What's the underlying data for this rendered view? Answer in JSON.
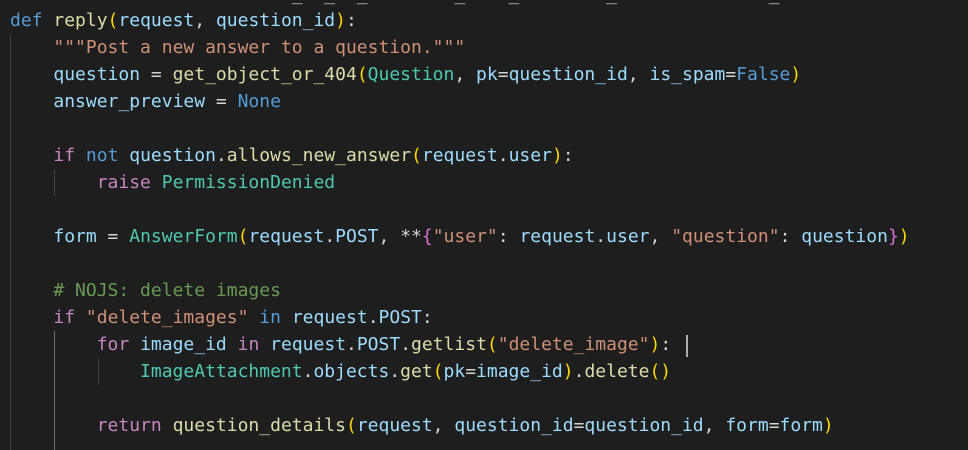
{
  "editor": {
    "language": "python",
    "top_cut_text": "                          _  _  _        _    _        _              _      ",
    "lines": [
      [
        {
          "t": "def",
          "c": "kw"
        },
        {
          "t": " ",
          "c": "pun"
        },
        {
          "t": "reply",
          "c": "fn"
        },
        {
          "t": "(",
          "c": "brk"
        },
        {
          "t": "request",
          "c": "var"
        },
        {
          "t": ", ",
          "c": "pun"
        },
        {
          "t": "question_id",
          "c": "var"
        },
        {
          "t": ")",
          "c": "brk"
        },
        {
          "t": ":",
          "c": "pun"
        }
      ],
      [
        {
          "t": "    ",
          "c": "pun"
        },
        {
          "t": "\"\"\"Post a new answer to a question.\"\"\"",
          "c": "str"
        }
      ],
      [
        {
          "t": "    ",
          "c": "pun"
        },
        {
          "t": "question",
          "c": "var"
        },
        {
          "t": " = ",
          "c": "pun"
        },
        {
          "t": "get_object_or_404",
          "c": "fn"
        },
        {
          "t": "(",
          "c": "brk"
        },
        {
          "t": "Question",
          "c": "cls"
        },
        {
          "t": ", ",
          "c": "pun"
        },
        {
          "t": "pk",
          "c": "var"
        },
        {
          "t": "=",
          "c": "pun"
        },
        {
          "t": "question_id",
          "c": "var"
        },
        {
          "t": ", ",
          "c": "pun"
        },
        {
          "t": "is_spam",
          "c": "var"
        },
        {
          "t": "=",
          "c": "pun"
        },
        {
          "t": "False",
          "c": "kw"
        },
        {
          "t": ")",
          "c": "brk"
        }
      ],
      [
        {
          "t": "    ",
          "c": "pun"
        },
        {
          "t": "answer_preview",
          "c": "var"
        },
        {
          "t": " = ",
          "c": "pun"
        },
        {
          "t": "None",
          "c": "kw"
        }
      ],
      [],
      [
        {
          "t": "    ",
          "c": "pun"
        },
        {
          "t": "if",
          "c": "ctrl"
        },
        {
          "t": " ",
          "c": "pun"
        },
        {
          "t": "not",
          "c": "kw"
        },
        {
          "t": " ",
          "c": "pun"
        },
        {
          "t": "question",
          "c": "var"
        },
        {
          "t": ".",
          "c": "pun"
        },
        {
          "t": "allows_new_answer",
          "c": "fn"
        },
        {
          "t": "(",
          "c": "brk"
        },
        {
          "t": "request",
          "c": "var"
        },
        {
          "t": ".",
          "c": "pun"
        },
        {
          "t": "user",
          "c": "var"
        },
        {
          "t": ")",
          "c": "brk"
        },
        {
          "t": ":",
          "c": "pun"
        }
      ],
      [
        {
          "t": "        ",
          "c": "pun"
        },
        {
          "t": "raise",
          "c": "ctrl"
        },
        {
          "t": " ",
          "c": "pun"
        },
        {
          "t": "PermissionDenied",
          "c": "cls"
        }
      ],
      [],
      [
        {
          "t": "    ",
          "c": "pun"
        },
        {
          "t": "form",
          "c": "var"
        },
        {
          "t": " = ",
          "c": "pun"
        },
        {
          "t": "AnswerForm",
          "c": "cls"
        },
        {
          "t": "(",
          "c": "brk"
        },
        {
          "t": "request",
          "c": "var"
        },
        {
          "t": ".",
          "c": "pun"
        },
        {
          "t": "POST",
          "c": "var"
        },
        {
          "t": ", **",
          "c": "pun"
        },
        {
          "t": "{",
          "c": "brk2"
        },
        {
          "t": "\"user\"",
          "c": "str"
        },
        {
          "t": ": ",
          "c": "pun"
        },
        {
          "t": "request",
          "c": "var"
        },
        {
          "t": ".",
          "c": "pun"
        },
        {
          "t": "user",
          "c": "var"
        },
        {
          "t": ", ",
          "c": "pun"
        },
        {
          "t": "\"question\"",
          "c": "str"
        },
        {
          "t": ": ",
          "c": "pun"
        },
        {
          "t": "question",
          "c": "var"
        },
        {
          "t": "}",
          "c": "brk2"
        },
        {
          "t": ")",
          "c": "brk"
        }
      ],
      [],
      [
        {
          "t": "    ",
          "c": "pun"
        },
        {
          "t": "# NOJS: delete images",
          "c": "cmt"
        }
      ],
      [
        {
          "t": "    ",
          "c": "pun"
        },
        {
          "t": "if",
          "c": "ctrl"
        },
        {
          "t": " ",
          "c": "pun"
        },
        {
          "t": "\"delete_images\"",
          "c": "str"
        },
        {
          "t": " ",
          "c": "pun"
        },
        {
          "t": "in",
          "c": "kw"
        },
        {
          "t": " ",
          "c": "pun"
        },
        {
          "t": "request",
          "c": "var"
        },
        {
          "t": ".",
          "c": "pun"
        },
        {
          "t": "POST",
          "c": "var"
        },
        {
          "t": ":",
          "c": "pun"
        }
      ],
      [
        {
          "t": "        ",
          "c": "pun"
        },
        {
          "t": "for",
          "c": "ctrl"
        },
        {
          "t": " ",
          "c": "pun"
        },
        {
          "t": "image_id",
          "c": "var"
        },
        {
          "t": " ",
          "c": "pun"
        },
        {
          "t": "in",
          "c": "ctrl"
        },
        {
          "t": " ",
          "c": "pun"
        },
        {
          "t": "request",
          "c": "var"
        },
        {
          "t": ".",
          "c": "pun"
        },
        {
          "t": "POST",
          "c": "var"
        },
        {
          "t": ".",
          "c": "pun"
        },
        {
          "t": "getlist",
          "c": "fn"
        },
        {
          "t": "(",
          "c": "brk"
        },
        {
          "t": "\"delete_image\"",
          "c": "str"
        },
        {
          "t": ")",
          "c": "brk"
        },
        {
          "t": ":",
          "c": "pun"
        }
      ],
      [
        {
          "t": "            ",
          "c": "pun"
        },
        {
          "t": "ImageAttachment",
          "c": "cls"
        },
        {
          "t": ".",
          "c": "pun"
        },
        {
          "t": "objects",
          "c": "var"
        },
        {
          "t": ".",
          "c": "pun"
        },
        {
          "t": "get",
          "c": "fn"
        },
        {
          "t": "(",
          "c": "brk"
        },
        {
          "t": "pk",
          "c": "var"
        },
        {
          "t": "=",
          "c": "pun"
        },
        {
          "t": "image_id",
          "c": "var"
        },
        {
          "t": ")",
          "c": "brk"
        },
        {
          "t": ".",
          "c": "pun"
        },
        {
          "t": "delete",
          "c": "fn"
        },
        {
          "t": "()",
          "c": "brk"
        }
      ],
      [],
      [
        {
          "t": "        ",
          "c": "pun"
        },
        {
          "t": "return",
          "c": "ctrl"
        },
        {
          "t": " ",
          "c": "pun"
        },
        {
          "t": "question_details",
          "c": "fn"
        },
        {
          "t": "(",
          "c": "brk"
        },
        {
          "t": "request",
          "c": "var"
        },
        {
          "t": ", ",
          "c": "pun"
        },
        {
          "t": "question_id",
          "c": "var"
        },
        {
          "t": "=",
          "c": "pun"
        },
        {
          "t": "question_id",
          "c": "var"
        },
        {
          "t": ", ",
          "c": "pun"
        },
        {
          "t": "form",
          "c": "var"
        },
        {
          "t": "=",
          "c": "pun"
        },
        {
          "t": "form",
          "c": "var"
        },
        {
          "t": ")",
          "c": "brk"
        }
      ]
    ]
  },
  "colors": {
    "background": "#1e1e1e",
    "keyword": "#569cd6",
    "control": "#c586c0",
    "function": "#dcdcaa",
    "variable": "#9cdcfe",
    "class": "#4ec9b0",
    "string": "#ce9178",
    "comment": "#6a9955",
    "bracket": "#ffd700",
    "bracket_nested": "#da70d6"
  }
}
